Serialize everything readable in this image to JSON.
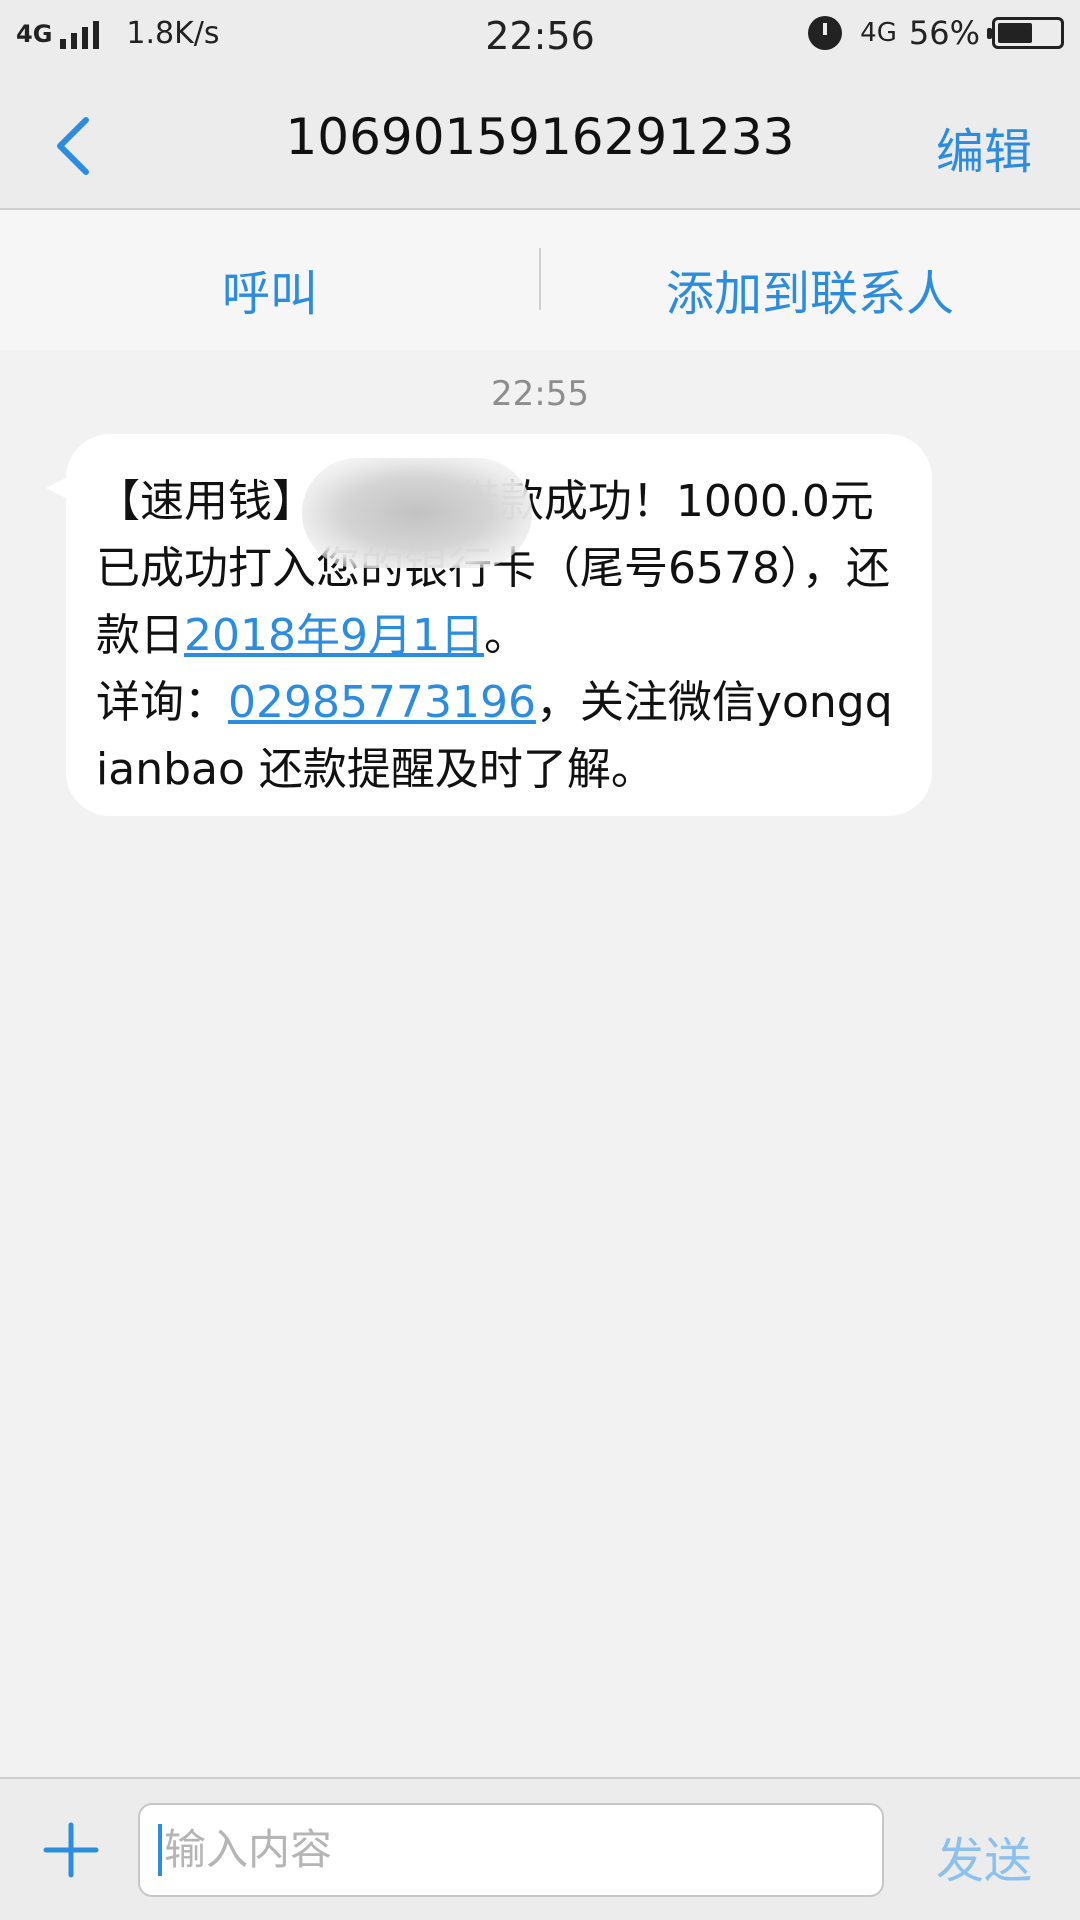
{
  "status_bar": {
    "network_left": "4G",
    "speed": "1.8K/s",
    "time": "22:56",
    "network_right": "4G",
    "battery_percent": "56%",
    "battery_level": 0.56
  },
  "nav": {
    "back_icon": "chevron-left-icon",
    "title": "1069015916291233",
    "edit_label": "编辑"
  },
  "actions": {
    "call_label": "呼叫",
    "add_contact_label": "添加到联系人"
  },
  "conversation": {
    "timestamp": "22:55",
    "message": {
      "part1": "【速用钱】          借款成功！1000.0元已成功打入您的银行卡（尾号6578），还款日",
      "date_link": "2018年9月1日",
      "part2": "。\n详询：",
      "phone_link": "02985773196",
      "part3": "，关注微信yongqianbao 还款提醒及时了解。"
    }
  },
  "input_bar": {
    "add_icon": "plus-icon",
    "placeholder": "输入内容",
    "send_label": "发送"
  },
  "colors": {
    "accent": "#2b8ce0",
    "send_disabled": "#8cc0ee",
    "background": "#f2f2f2"
  }
}
